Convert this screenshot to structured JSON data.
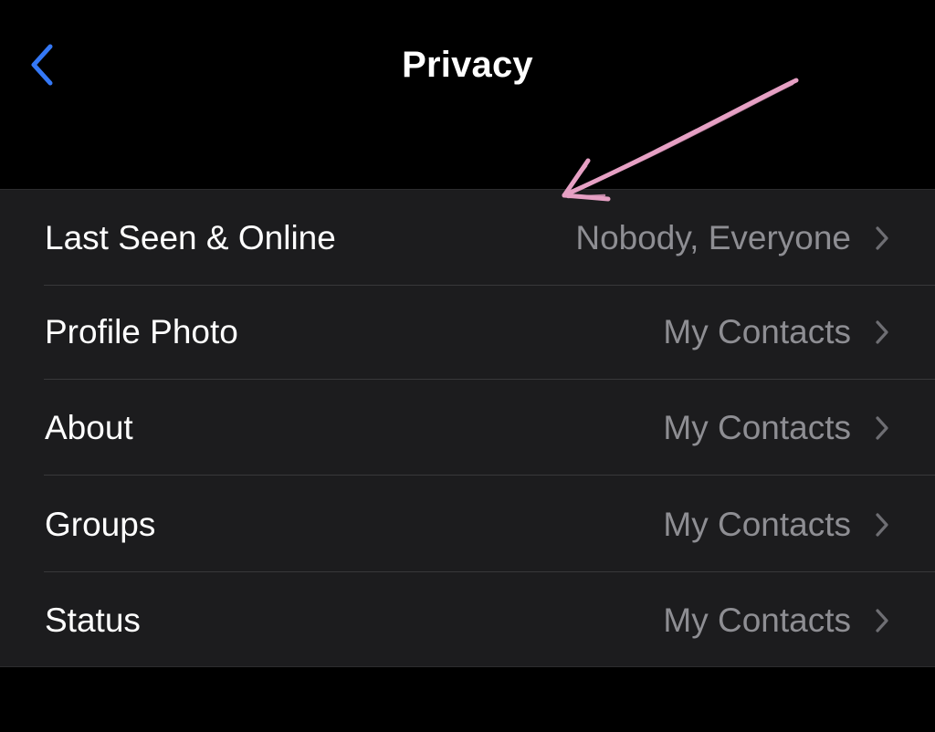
{
  "nav": {
    "title": "Privacy",
    "back_icon": "chevron-left-icon",
    "accent_color": "#3478f6"
  },
  "rows": [
    {
      "label": "Last Seen & Online",
      "value": "Nobody, Everyone"
    },
    {
      "label": "Profile Photo",
      "value": "My Contacts"
    },
    {
      "label": "About",
      "value": "My Contacts"
    },
    {
      "label": "Groups",
      "value": "My Contacts"
    },
    {
      "label": "Status",
      "value": "My Contacts"
    }
  ],
  "annotation": {
    "type": "hand-drawn-arrow",
    "color": "#e6a0c4"
  },
  "colors": {
    "background": "#000000",
    "group_background": "#1c1c1e",
    "label_text": "#ffffff",
    "value_text": "#8e8e93",
    "chevron": "#8e8e93",
    "separator": "#38383a"
  }
}
